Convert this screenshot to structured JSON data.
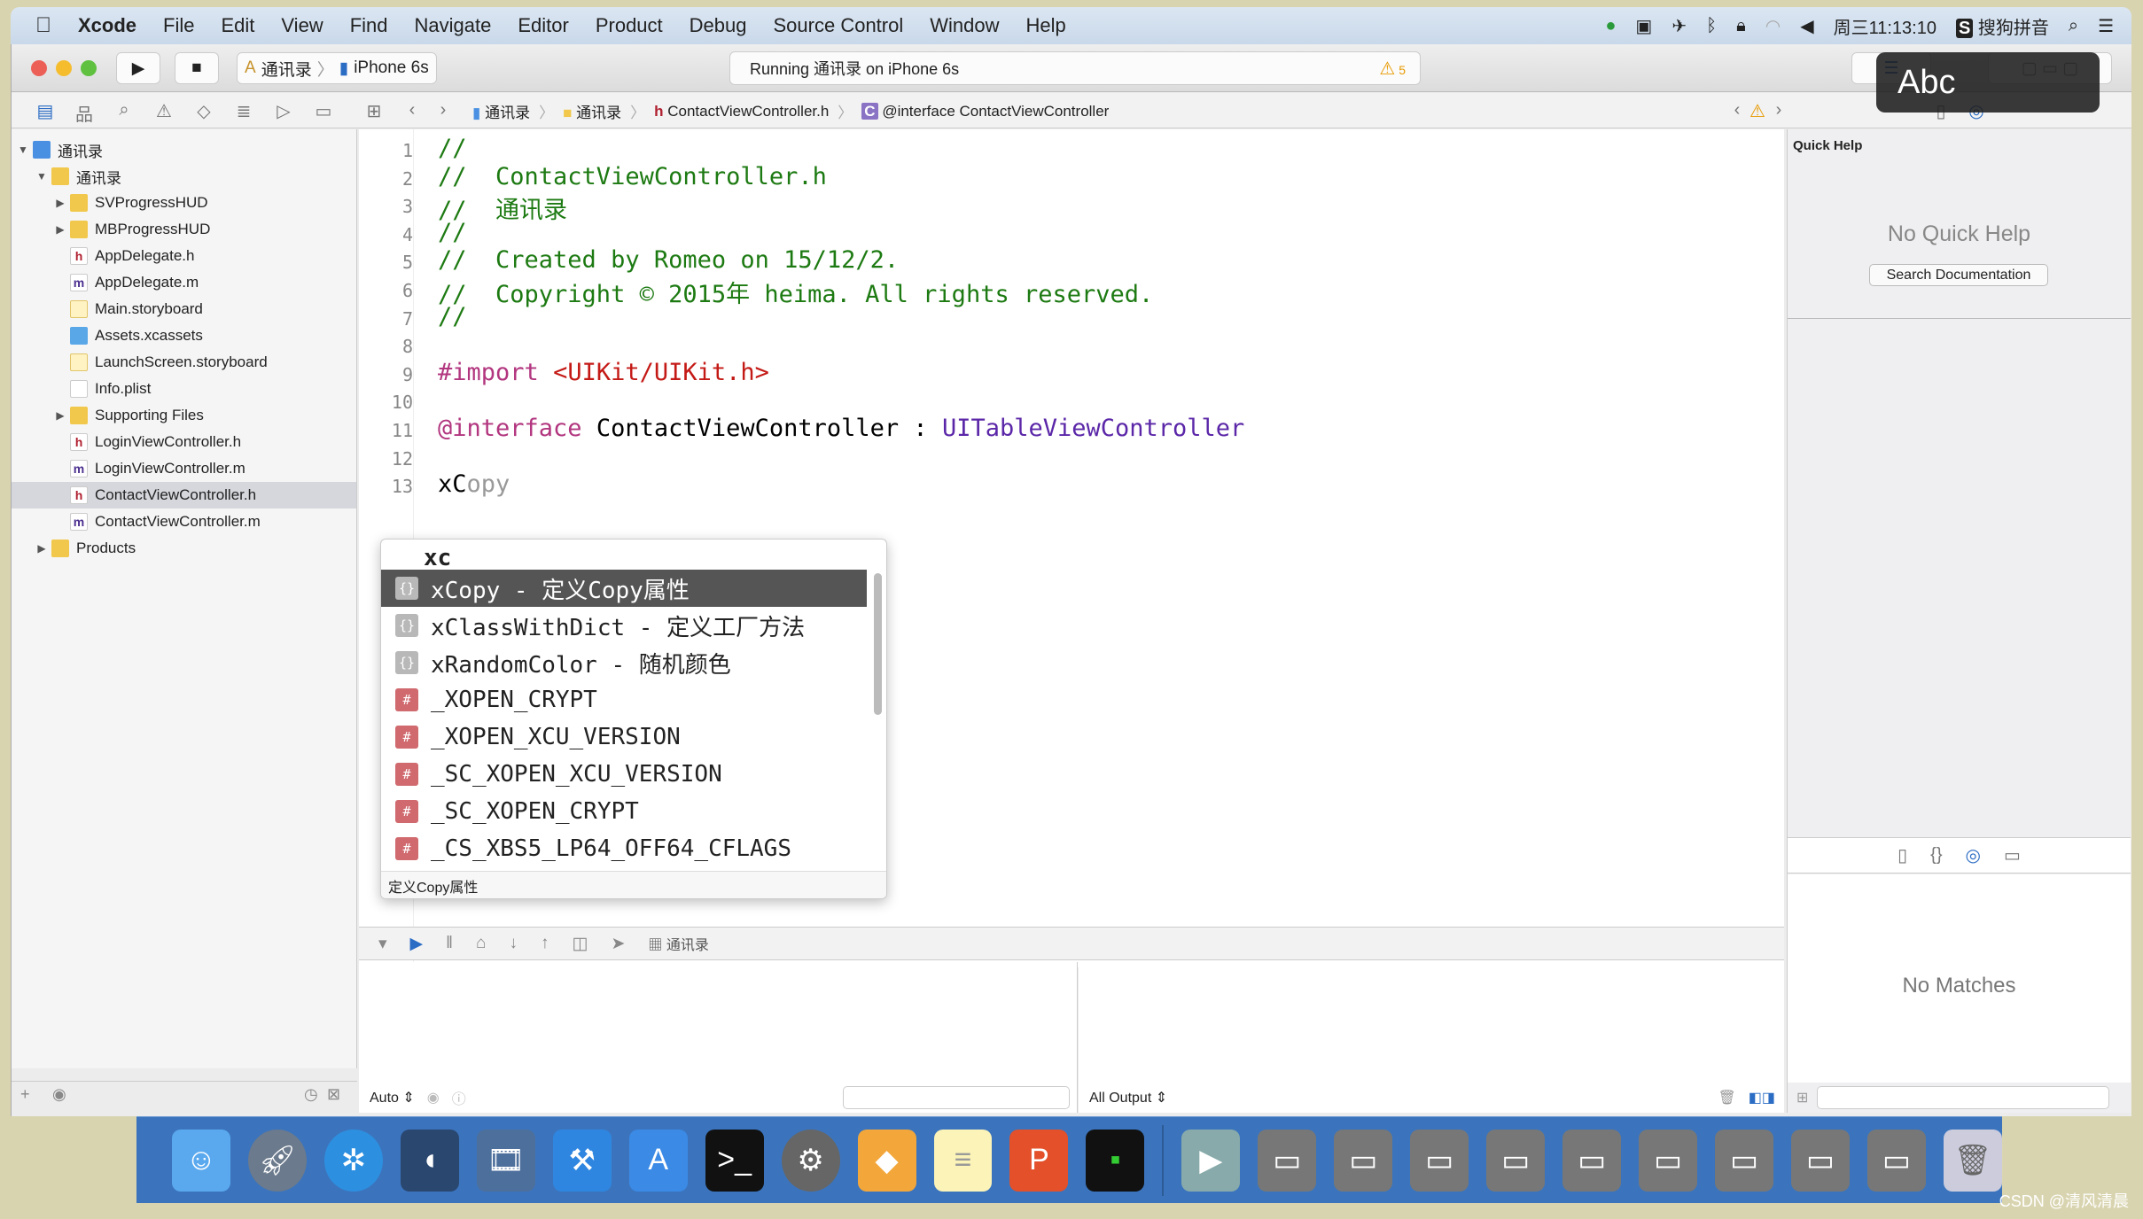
{
  "menubar": {
    "apple": "",
    "app": "Xcode",
    "items": [
      "File",
      "Edit",
      "View",
      "Find",
      "Navigate",
      "Editor",
      "Product",
      "Debug",
      "Source Control",
      "Window",
      "Help"
    ],
    "clock": "周三11:13:10",
    "input_method": "搜狗拼音"
  },
  "toolbar": {
    "scheme": "通讯录",
    "device": "iPhone 6s",
    "activity": "Running 通讯录 on iPhone 6s",
    "warnings": "5"
  },
  "jumpbar": [
    "通讯录",
    "通讯录",
    "ContactViewController.h",
    "@interface ContactViewController"
  ],
  "navigator": {
    "items": [
      {
        "label": "通讯录",
        "type": "proj",
        "depth": 0,
        "tri": "▼"
      },
      {
        "label": "通讯录",
        "type": "folder",
        "depth": 1,
        "tri": "▼"
      },
      {
        "label": "SVProgressHUD",
        "type": "folder",
        "depth": 2,
        "tri": "▶"
      },
      {
        "label": "MBProgressHUD",
        "type": "folder",
        "depth": 2,
        "tri": "▶"
      },
      {
        "label": "AppDelegate.h",
        "type": "h",
        "depth": 2,
        "tri": ""
      },
      {
        "label": "AppDelegate.m",
        "type": "m",
        "depth": 2,
        "tri": ""
      },
      {
        "label": "Main.storyboard",
        "type": "sb",
        "depth": 2,
        "tri": ""
      },
      {
        "label": "Assets.xcassets",
        "type": "as",
        "depth": 2,
        "tri": ""
      },
      {
        "label": "LaunchScreen.storyboard",
        "type": "sb",
        "depth": 2,
        "tri": ""
      },
      {
        "label": "Info.plist",
        "type": "pl",
        "depth": 2,
        "tri": ""
      },
      {
        "label": "Supporting Files",
        "type": "folder",
        "depth": 2,
        "tri": "▶"
      },
      {
        "label": "LoginViewController.h",
        "type": "h",
        "depth": 2,
        "tri": ""
      },
      {
        "label": "LoginViewController.m",
        "type": "m",
        "depth": 2,
        "tri": ""
      },
      {
        "label": "ContactViewController.h",
        "type": "h",
        "depth": 2,
        "tri": "",
        "selected": true
      },
      {
        "label": "ContactViewController.m",
        "type": "m",
        "depth": 2,
        "tri": ""
      },
      {
        "label": "Products",
        "type": "folder",
        "depth": 1,
        "tri": "▶"
      }
    ]
  },
  "editor": {
    "lines": [
      {
        "n": "1",
        "html": "<span class='cm'>//</span>"
      },
      {
        "n": "2",
        "html": "<span class='cm'>//  ContactViewController.h</span>"
      },
      {
        "n": "3",
        "html": "<span class='cm'>//  通讯录</span>"
      },
      {
        "n": "4",
        "html": "<span class='cm'>//</span>"
      },
      {
        "n": "5",
        "html": "<span class='cm'>//  Created by Romeo on 15/12/2.</span>"
      },
      {
        "n": "6",
        "html": "<span class='cm'>//  Copyright © 2015年 heima. All rights reserved.</span>"
      },
      {
        "n": "7",
        "html": "<span class='cm'>//</span>"
      },
      {
        "n": "8",
        "html": ""
      },
      {
        "n": "9",
        "html": "<span class='kw'>#import</span> <span class='str'>&lt;UIKit/UIKit.h&gt;</span>"
      },
      {
        "n": "10",
        "html": ""
      },
      {
        "n": "11",
        "html": "<span class='kw'>@interface</span> ContactViewController : <span class='ty'>UITableViewController</span>"
      },
      {
        "n": "12",
        "html": ""
      },
      {
        "n": "13",
        "html": "xC<span class='ghost'>opy</span>"
      }
    ]
  },
  "completion": {
    "typed": "xc",
    "items": [
      {
        "icon": "snippet",
        "text": "xCopy - 定义Copy属性",
        "selected": true
      },
      {
        "icon": "snippet",
        "text": "xClassWithDict - 定义工厂方法"
      },
      {
        "icon": "snippet",
        "text": "xRandomColor - 随机颜色"
      },
      {
        "icon": "macro",
        "text": "_XOPEN_CRYPT"
      },
      {
        "icon": "macro",
        "text": "_XOPEN_XCU_VERSION"
      },
      {
        "icon": "macro",
        "text": "_SC_XOPEN_XCU_VERSION"
      },
      {
        "icon": "macro",
        "text": "_SC_XOPEN_CRYPT"
      },
      {
        "icon": "macro",
        "text": "_CS_XBS5_LP64_OFF64_CFLAGS"
      }
    ],
    "footer": "定义Copy属性"
  },
  "debug": {
    "target": "通讯录",
    "auto": "Auto ⇕",
    "output": "All Output ⇕"
  },
  "inspector": {
    "title": "Quick Help",
    "empty": "No Quick Help",
    "search_button": "Search Documentation",
    "no_matches": "No Matches"
  },
  "overlay": {
    "abc": "Abc"
  },
  "watermark": "CSDN @清风清晨"
}
